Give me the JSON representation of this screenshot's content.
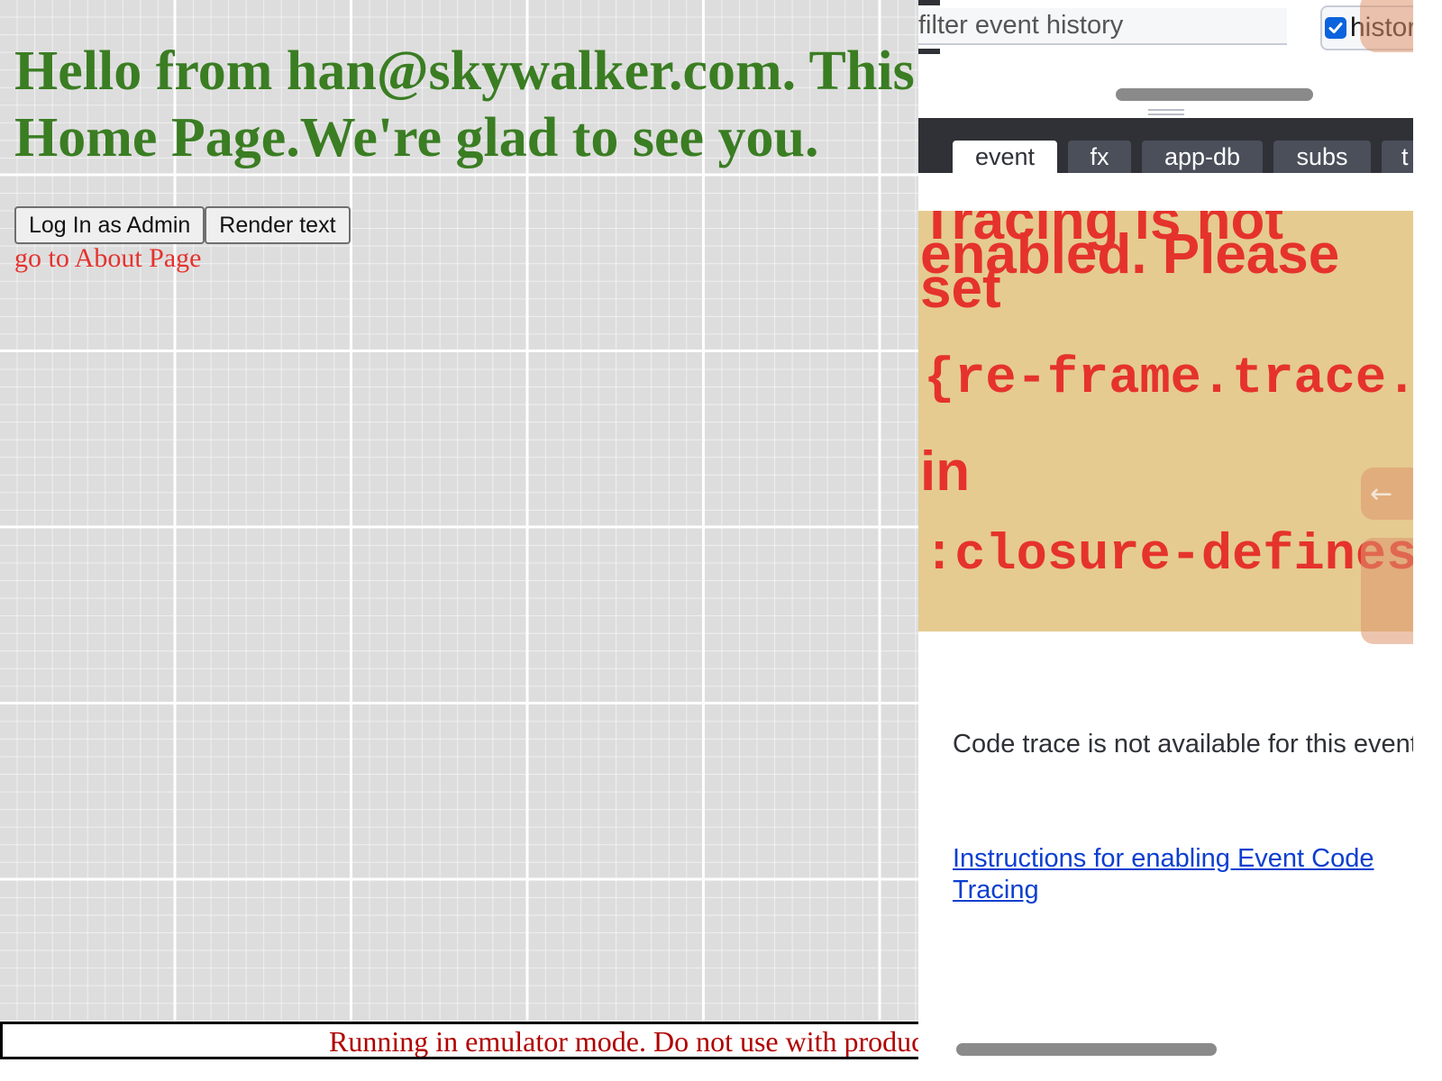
{
  "app": {
    "greeting": "Hello from han@skywalker.com. This is the Home Page.We're glad to see you.",
    "buttons": {
      "login_admin": "Log In as Admin",
      "render_text": "Render text"
    },
    "about_link": "go to About Page",
    "emulator_banner": "Running in emulator mode. Do not use with production credentials."
  },
  "devtools": {
    "filter": {
      "placeholder": "filter event history",
      "value": ""
    },
    "history_toggle": {
      "label": "history",
      "checked": true
    },
    "tabs": [
      {
        "label": "event",
        "active": true
      },
      {
        "label": "fx",
        "active": false
      },
      {
        "label": "app-db",
        "active": false
      },
      {
        "label": "subs",
        "active": false
      },
      {
        "label": "t",
        "active": false
      }
    ],
    "warning": {
      "text": "Tracing is not enabled. Please set",
      "code": "{re-frame.trace.trace-enabled? true}",
      "in_word": "in",
      "code2": ":closure-defines"
    },
    "side_arrow_icon": "left-arrow-icon",
    "code_trace_msg": "Code trace is not available for this event",
    "instructions_link": "Instructions for enabling Event Code Tracing"
  },
  "colors": {
    "greeting": "#3a7d22",
    "link_red": "#e5322d",
    "banner_text": "#b00000",
    "devtools_dark": "#2f3137",
    "warning_bg": "#e5cb90",
    "link_blue": "#0b3fd0",
    "checkbox_blue": "#0b63dd"
  }
}
